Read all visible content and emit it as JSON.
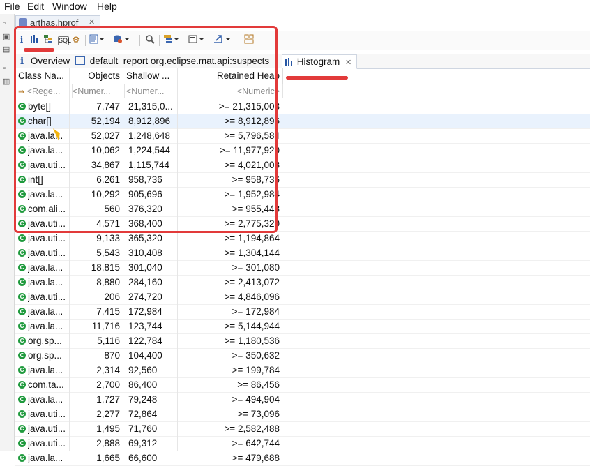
{
  "menu": [
    "File",
    "Edit",
    "Window",
    "Help"
  ],
  "file_tab": {
    "label": "arthas.hprof",
    "close": "✕"
  },
  "toolbar_icons": [
    "info-icon",
    "histogram-icon",
    "dominator-tree-icon",
    "oql-icon",
    "thread-overview-icon",
    "run-report-icon",
    "query-browser-icon",
    "search-icon",
    "group-by-icon",
    "calculate-icon",
    "export-icon",
    "compare-icon"
  ],
  "tabs": [
    {
      "icon": "i",
      "label": "Overview"
    },
    {
      "icon": "report",
      "label": "default_report  org.eclipse.mat.api:suspects"
    },
    {
      "icon": "histogram",
      "label": "Histogram",
      "close": "✕"
    }
  ],
  "table": {
    "columns": [
      "Class Na...",
      "Objects",
      "Shallow ...",
      "Retained Heap"
    ],
    "filters": [
      "<Rege...",
      "<Numer...",
      "<Numer...",
      "<Numeric>"
    ],
    "rows": [
      {
        "name": "byte[]",
        "objects": "7,747",
        "shallow": "21,315,0...",
        "retained": ">= 21,315,008"
      },
      {
        "name": "char[]",
        "objects": "52,194",
        "shallow": "8,912,896",
        "retained": ">= 8,912,896"
      },
      {
        "name": "java.la...",
        "objects": "52,027",
        "shallow": "1,248,648",
        "retained": ">= 5,796,584"
      },
      {
        "name": "java.la...",
        "objects": "10,062",
        "shallow": "1,224,544",
        "retained": ">= 11,977,920"
      },
      {
        "name": "java.uti...",
        "objects": "34,867",
        "shallow": "1,115,744",
        "retained": ">= 4,021,008"
      },
      {
        "name": "int[]",
        "objects": "6,261",
        "shallow": "958,736",
        "retained": ">= 958,736"
      },
      {
        "name": "java.la...",
        "objects": "10,292",
        "shallow": "905,696",
        "retained": ">= 1,952,984"
      },
      {
        "name": "com.ali...",
        "objects": "560",
        "shallow": "376,320",
        "retained": ">= 955,448"
      },
      {
        "name": "java.uti...",
        "objects": "4,571",
        "shallow": "368,400",
        "retained": ">= 2,775,320"
      },
      {
        "name": "java.uti...",
        "objects": "9,133",
        "shallow": "365,320",
        "retained": ">= 1,194,864"
      },
      {
        "name": "java.uti...",
        "objects": "5,543",
        "shallow": "310,408",
        "retained": ">= 1,304,144"
      },
      {
        "name": "java.la...",
        "objects": "18,815",
        "shallow": "301,040",
        "retained": ">= 301,080"
      },
      {
        "name": "java.la...",
        "objects": "8,880",
        "shallow": "284,160",
        "retained": ">= 2,413,072"
      },
      {
        "name": "java.uti...",
        "objects": "206",
        "shallow": "274,720",
        "retained": ">= 4,846,096"
      },
      {
        "name": "java.la...",
        "objects": "7,415",
        "shallow": "172,984",
        "retained": ">= 172,984"
      },
      {
        "name": "java.la...",
        "objects": "11,716",
        "shallow": "123,744",
        "retained": ">= 5,144,944"
      },
      {
        "name": "org.sp...",
        "objects": "5,116",
        "shallow": "122,784",
        "retained": ">= 1,180,536"
      },
      {
        "name": "org.sp...",
        "objects": "870",
        "shallow": "104,400",
        "retained": ">= 350,632"
      },
      {
        "name": "java.la...",
        "objects": "2,314",
        "shallow": "92,560",
        "retained": ">= 199,784"
      },
      {
        "name": "com.ta...",
        "objects": "2,700",
        "shallow": "86,400",
        "retained": ">= 86,456"
      },
      {
        "name": "java.la...",
        "objects": "1,727",
        "shallow": "79,248",
        "retained": ">= 494,904"
      },
      {
        "name": "java.uti...",
        "objects": "2,277",
        "shallow": "72,864",
        "retained": ">= 73,096"
      },
      {
        "name": "java.uti...",
        "objects": "1,495",
        "shallow": "71,760",
        "retained": ">= 2,582,488"
      },
      {
        "name": "java.uti...",
        "objects": "2,888",
        "shallow": "69,312",
        "retained": ">= 642,744"
      },
      {
        "name": "java.la...",
        "objects": "1,665",
        "shallow": "66,600",
        "retained": ">= 479,688"
      }
    ]
  },
  "colors": {
    "annotation": "#e23a3a",
    "class_icon": "#1f9a3d",
    "selected_row": "#e9f2fd"
  }
}
